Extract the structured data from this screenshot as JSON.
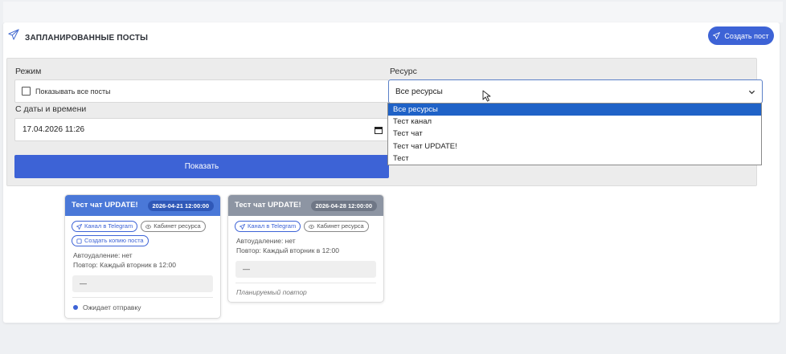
{
  "header": {
    "title": "ЗАПЛАНИРОВАННЫЕ ПОСТЫ",
    "create_button": "Создать пост"
  },
  "filters": {
    "mode_label": "Режим",
    "show_all_label": "Показывать все посты",
    "show_all_checked": false,
    "date_label": "С даты и времени",
    "date_value": "17.04.2026 11:26",
    "resource_label": "Ресурс",
    "resource_selected": "Все ресурсы",
    "resource_options": [
      "Все ресурсы",
      "Тест канал",
      "Тест чат",
      "Тест чат UPDATE!",
      "Тест"
    ],
    "show_button": "Показать"
  },
  "cards": [
    {
      "title": "Тест чат UPDATE!",
      "date": "2026-04-21 12:00:00",
      "chip_telegram": "Канал в Telegram",
      "chip_cabinet": "Кабинет ресурса",
      "chip_copy": "Создать копию поста",
      "autodelete": "Автоудаление: нет",
      "repeat": "Повтор: Каждый вторник в 12:00",
      "text": "—",
      "status": "Ожидает отправку",
      "header_color": "#4a78d8"
    },
    {
      "title": "Тест чат UPDATE!",
      "date": "2026-04-28 12:00:00",
      "chip_telegram": "Канал в Telegram",
      "chip_cabinet": "Кабинет ресурса",
      "autodelete": "Автоудаление: нет",
      "repeat": "Повтор: Каждый вторник в 12:00",
      "text": "—",
      "note": "Планируемый повтор",
      "header_color": "#8d95a3"
    }
  ],
  "colors": {
    "accent": "#3d63d6",
    "dropdown_selected": "#1f62c7"
  }
}
